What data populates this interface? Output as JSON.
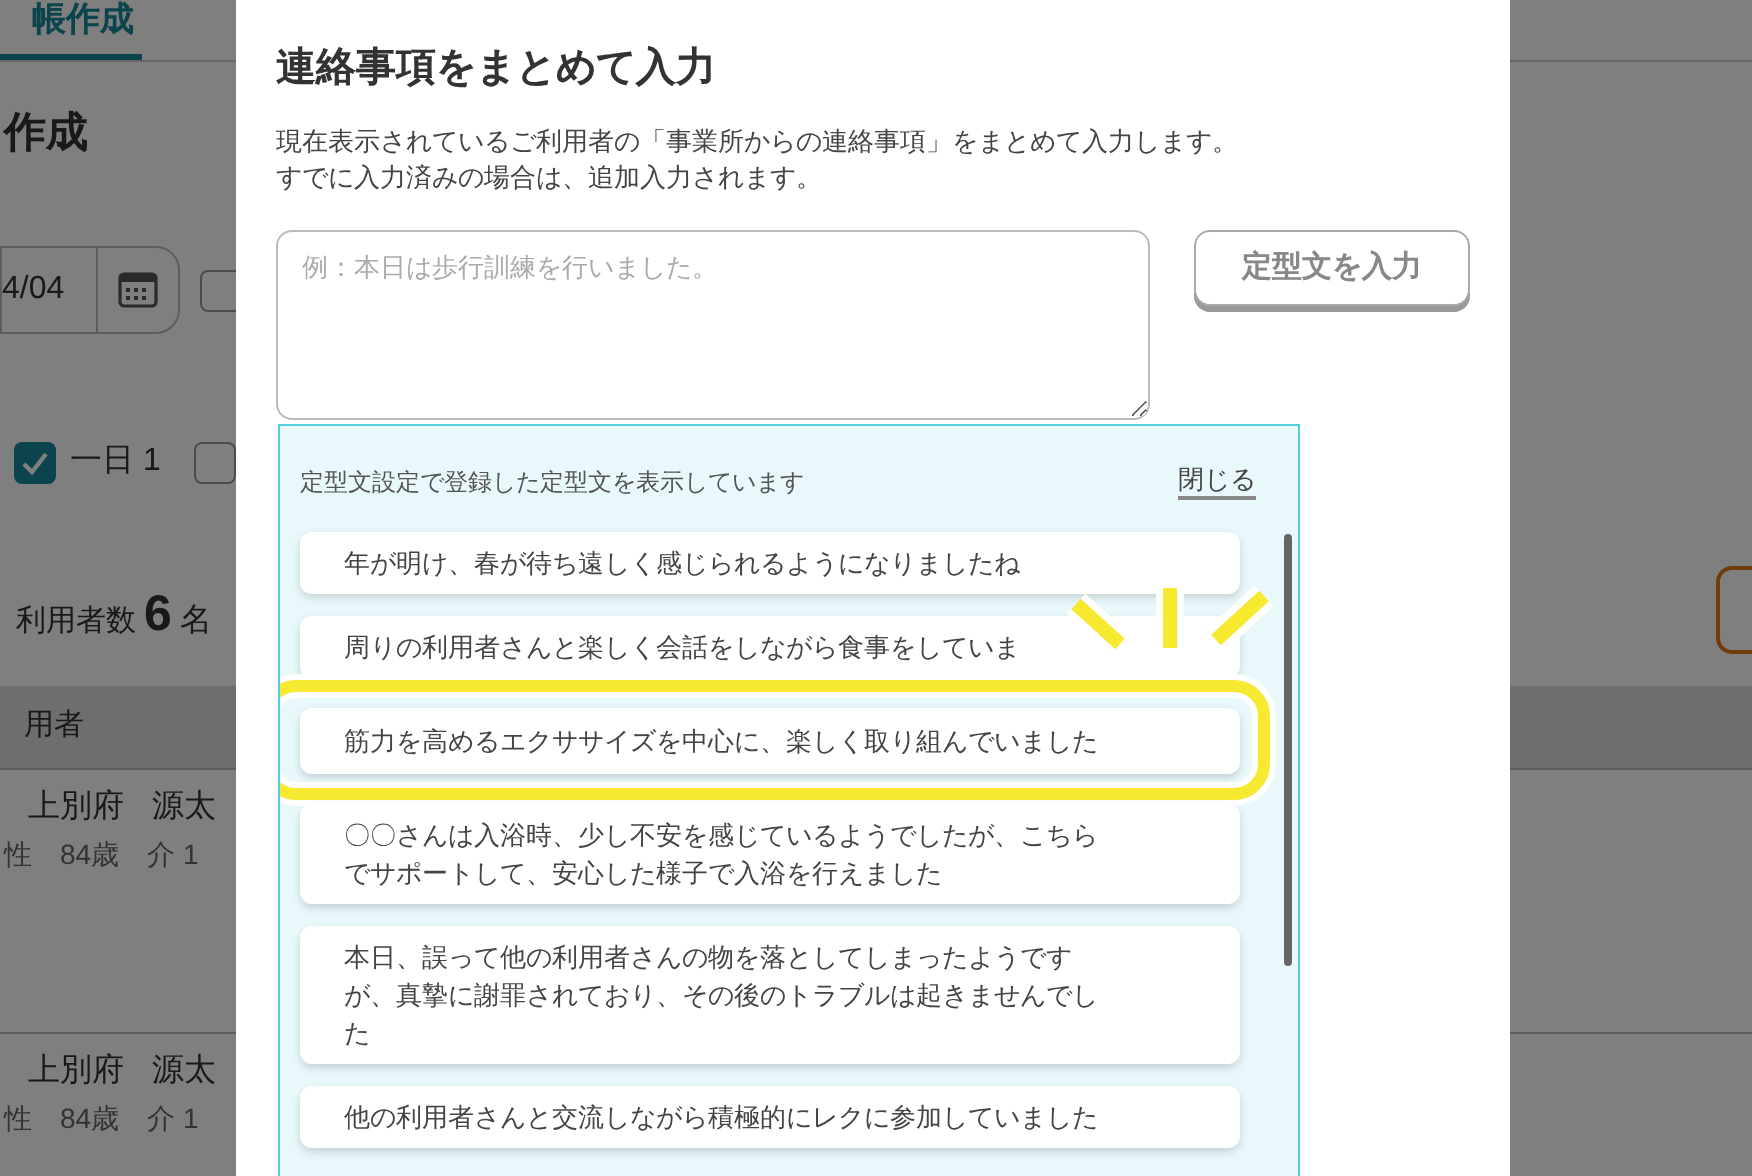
{
  "background_page": {
    "tab": {
      "label": "帳作成",
      "selected": true
    },
    "heading": "作成",
    "date_field": {
      "value": "4/04"
    },
    "extra_checkbox": {
      "checked": false
    },
    "filters": [
      {
        "label": "一日 1",
        "checked": true
      },
      {
        "checked": false
      }
    ],
    "user_count": {
      "label": "利用者数",
      "count": "6",
      "unit": "名"
    },
    "table": {
      "columns": [
        "用者"
      ],
      "rows": [
        {
          "last_name": "上別府",
          "first_name": "源太",
          "gender": "性",
          "age": "84歳",
          "care_level": "介 1"
        },
        {
          "last_name": "上別府",
          "first_name": "源太",
          "gender": "性",
          "age": "84歳",
          "care_level": "介 1"
        }
      ]
    }
  },
  "dialog": {
    "title": "連絡事項をまとめて入力",
    "description": [
      "現在表示されているご利用者の「事業所からの連絡事項」をまとめて入力します。",
      "すでに入力済みの場合は、追加入力されます。"
    ],
    "textarea": {
      "placeholder": "例：本日は歩行訓練を行いました。"
    },
    "template_button": "定型文を入力",
    "template_panel": {
      "caption": "定型文設定で登録した定型文を表示しています",
      "close_link": "閉じる",
      "items": [
        {
          "text": "年が明け、春が待ち遠しく感じられるようになりましたね",
          "highlighted": false
        },
        {
          "text": "周りの利用者さんと楽しく会話をしながら食事をしていま",
          "highlighted": false
        },
        {
          "text": "筋力を高めるエクササイズを中心に、楽しく取り組んでいました",
          "highlighted": true
        },
        {
          "text": "〇〇さんは入浴時、少し不安を感じているようでしたが、こちらでサポートして、安心した様子で入浴を行えました",
          "highlighted": false
        },
        {
          "text": "本日、誤って他の利用者さんの物を落としてしまったようですが、真摯に謝罪されており、その後のトラブルは起きませんでした",
          "highlighted": false
        },
        {
          "text": "他の利用者さんと交流しながら積極的にレクに参加していました",
          "highlighted": false
        }
      ]
    }
  }
}
